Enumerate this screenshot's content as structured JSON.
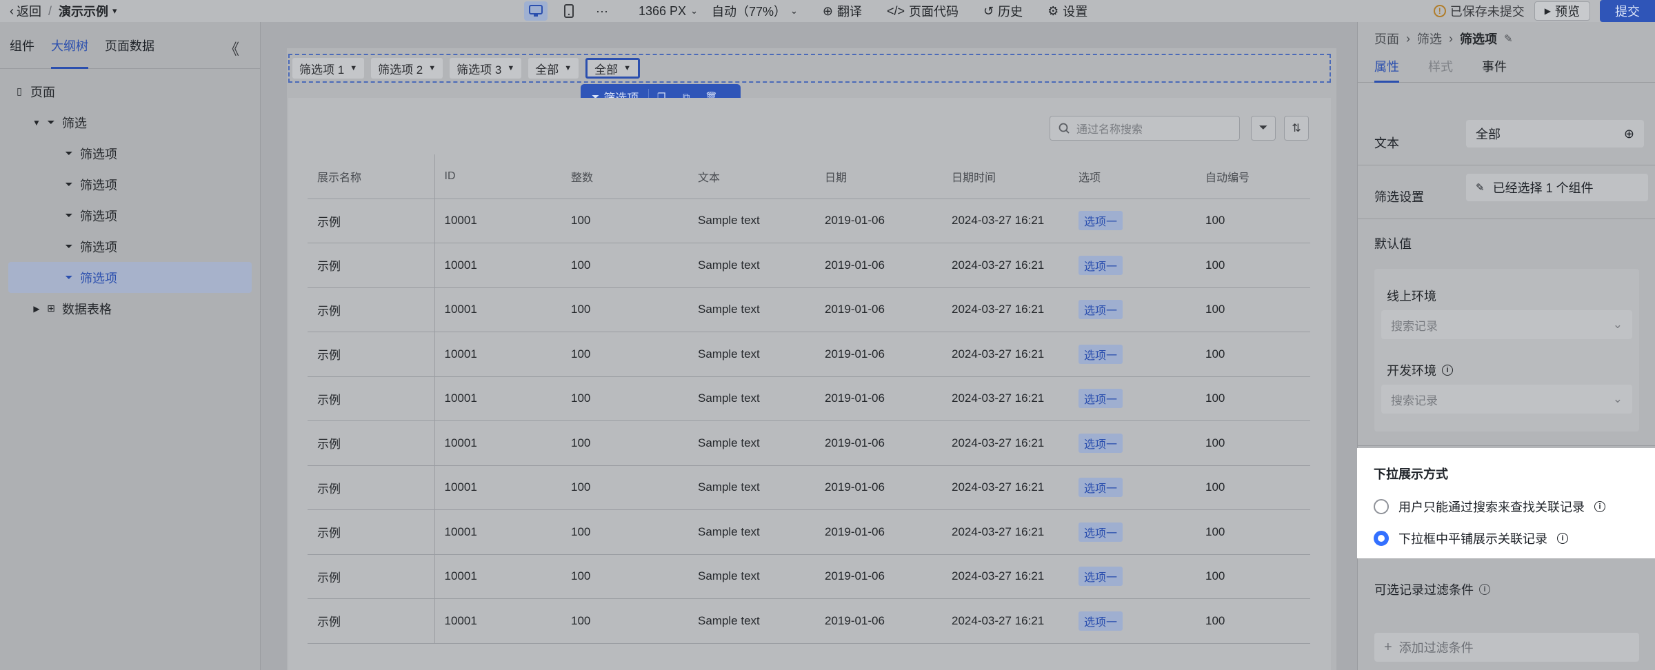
{
  "topbar": {
    "back_label": "返回",
    "separator": "/",
    "app_title": "演示示例",
    "more": "···",
    "width_label": "1366 PX",
    "zoom_label": "自动（77%）",
    "translate_label": "翻译",
    "code_label": "页面代码",
    "history_label": "历史",
    "settings_label": "设置",
    "unsaved_label": "已保存未提交",
    "preview_label": "预览",
    "submit_label": "提交"
  },
  "left": {
    "tabs": [
      {
        "label": "组件"
      },
      {
        "label": "大纲树"
      },
      {
        "label": "页面数据"
      }
    ],
    "collapse_glyph": "《",
    "tree": [
      {
        "label": "页面"
      },
      {
        "label": "筛选"
      },
      {
        "label": "筛选项"
      },
      {
        "label": "筛选项"
      },
      {
        "label": "筛选项"
      },
      {
        "label": "筛选项"
      },
      {
        "label": "筛选项"
      },
      {
        "label": "数据表格"
      }
    ]
  },
  "canvas": {
    "filters": [
      {
        "label": "筛选项 1"
      },
      {
        "label": "筛选项 2"
      },
      {
        "label": "筛选项 3"
      },
      {
        "label": "全部"
      },
      {
        "label": "全部"
      }
    ],
    "float_label": "筛选项",
    "search_placeholder": "通过名称搜索",
    "columns": [
      "展示名称",
      "ID",
      "整数",
      "文本",
      "日期",
      "日期时间",
      "选项",
      "自动编号"
    ],
    "rows": [
      {
        "name": "示例",
        "id": "10001",
        "int": "100",
        "text": "Sample text",
        "date": "2019-01-06",
        "datetime": "2024-03-27 16:21",
        "option": "选项一",
        "auto": "100"
      },
      {
        "name": "示例",
        "id": "10001",
        "int": "100",
        "text": "Sample text",
        "date": "2019-01-06",
        "datetime": "2024-03-27 16:21",
        "option": "选项一",
        "auto": "100"
      },
      {
        "name": "示例",
        "id": "10001",
        "int": "100",
        "text": "Sample text",
        "date": "2019-01-06",
        "datetime": "2024-03-27 16:21",
        "option": "选项一",
        "auto": "100"
      },
      {
        "name": "示例",
        "id": "10001",
        "int": "100",
        "text": "Sample text",
        "date": "2019-01-06",
        "datetime": "2024-03-27 16:21",
        "option": "选项一",
        "auto": "100"
      },
      {
        "name": "示例",
        "id": "10001",
        "int": "100",
        "text": "Sample text",
        "date": "2019-01-06",
        "datetime": "2024-03-27 16:21",
        "option": "选项一",
        "auto": "100"
      },
      {
        "name": "示例",
        "id": "10001",
        "int": "100",
        "text": "Sample text",
        "date": "2019-01-06",
        "datetime": "2024-03-27 16:21",
        "option": "选项一",
        "auto": "100"
      },
      {
        "name": "示例",
        "id": "10001",
        "int": "100",
        "text": "Sample text",
        "date": "2019-01-06",
        "datetime": "2024-03-27 16:21",
        "option": "选项一",
        "auto": "100"
      },
      {
        "name": "示例",
        "id": "10001",
        "int": "100",
        "text": "Sample text",
        "date": "2019-01-06",
        "datetime": "2024-03-27 16:21",
        "option": "选项一",
        "auto": "100"
      },
      {
        "name": "示例",
        "id": "10001",
        "int": "100",
        "text": "Sample text",
        "date": "2019-01-06",
        "datetime": "2024-03-27 16:21",
        "option": "选项一",
        "auto": "100"
      },
      {
        "name": "示例",
        "id": "10001",
        "int": "100",
        "text": "Sample text",
        "date": "2019-01-06",
        "datetime": "2024-03-27 16:21",
        "option": "选项一",
        "auto": "100"
      }
    ]
  },
  "right": {
    "breadcrumb": [
      "页面",
      "筛选",
      "筛选项"
    ],
    "tabs": [
      {
        "label": "属性"
      },
      {
        "label": "样式"
      },
      {
        "label": "事件"
      }
    ],
    "text_label": "文本",
    "text_value": "全部",
    "filter_settings_label": "筛选设置",
    "filter_settings_value": "已经选择 1 个组件",
    "default_label": "默认值",
    "online_env_label": "线上环境",
    "online_placeholder": "搜索记录",
    "dev_env_label": "开发环境",
    "dev_placeholder": "搜索记录",
    "dropdown_title": "下拉展示方式",
    "radio_search_only": "用户只能通过搜索来查找关联记录",
    "radio_tile": "下拉框中平铺展示关联记录",
    "optional_filter_label": "可选记录过滤条件",
    "add_filter_label": "添加过滤条件"
  }
}
